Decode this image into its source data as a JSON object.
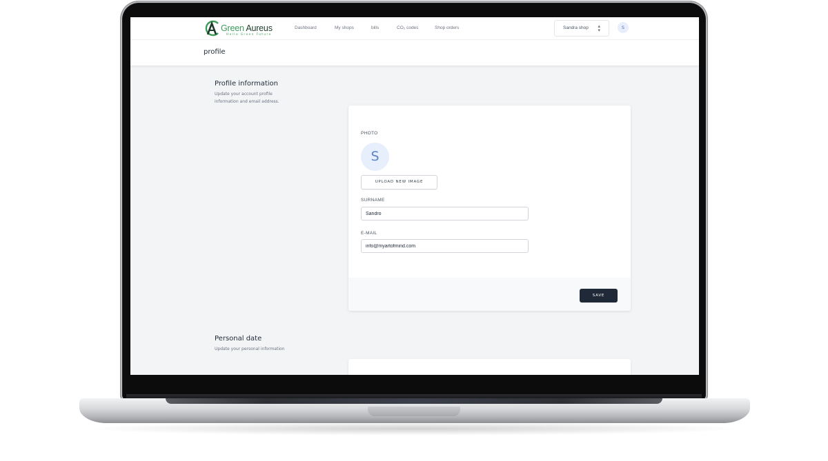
{
  "brand": {
    "name_part1": "Green",
    "name_part2": " Aureus",
    "tagline": "Hello Green Future"
  },
  "nav": {
    "items": [
      "Dashboard",
      "My shops",
      "bills",
      "CO₂ codes",
      "Shop orders"
    ],
    "shop_select": "Sandra shop",
    "user_initial": "S"
  },
  "page": {
    "title": "profile"
  },
  "profile_section": {
    "title": "Profile information",
    "description": "Update your account profile information and email address.",
    "photo_label": "PHOTO",
    "photo_initial": "S",
    "upload_label": "UPLOAD NEW IMAGE",
    "surname_label": "SURNAME",
    "surname_value": "Sandro",
    "email_label": "E-MAIL",
    "email_value": "info@myartofmind.com",
    "save_label": "SAVE"
  },
  "personal_section": {
    "title": "Personal date",
    "description": "Update your personal information"
  },
  "colors": {
    "brand_green": "#3d9b5b",
    "brand_dark": "#1d3b2a",
    "save_button": "#1f2937",
    "avatar_bg": "#e7eefc"
  }
}
